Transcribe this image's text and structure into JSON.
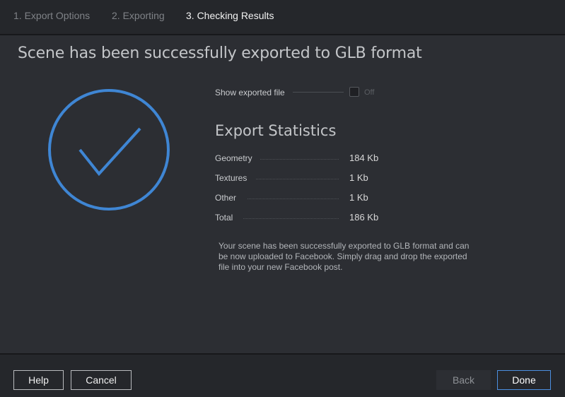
{
  "steps": [
    {
      "label": "1. Export Options",
      "active": false
    },
    {
      "label": "2. Exporting",
      "active": false
    },
    {
      "label": "3. Checking Results",
      "active": true
    }
  ],
  "title": "Scene has been successfully exported to GLB format",
  "show_file": {
    "label": "Show exported file",
    "state": "Off",
    "checked": false
  },
  "stats": {
    "title": "Export Statistics",
    "rows": [
      {
        "label": "Geometry",
        "value": "184 Kb"
      },
      {
        "label": "Textures",
        "value": "1 Kb"
      },
      {
        "label": "Other",
        "value": "1 Kb"
      },
      {
        "label": "Total",
        "value": "186 Kb"
      }
    ]
  },
  "message": "Your scene has been successfully exported to GLB format and can be now uploaded to Facebook. Simply drag and drop the exported file into your new Facebook post.",
  "buttons": {
    "help": "Help",
    "cancel": "Cancel",
    "back": "Back",
    "done": "Done"
  },
  "colors": {
    "accent": "#3f86d4",
    "background": "#2c2e33",
    "header": "#25272b"
  },
  "icons": {
    "success": "checkmark-circle-icon",
    "toggle": "checkbox-icon"
  }
}
